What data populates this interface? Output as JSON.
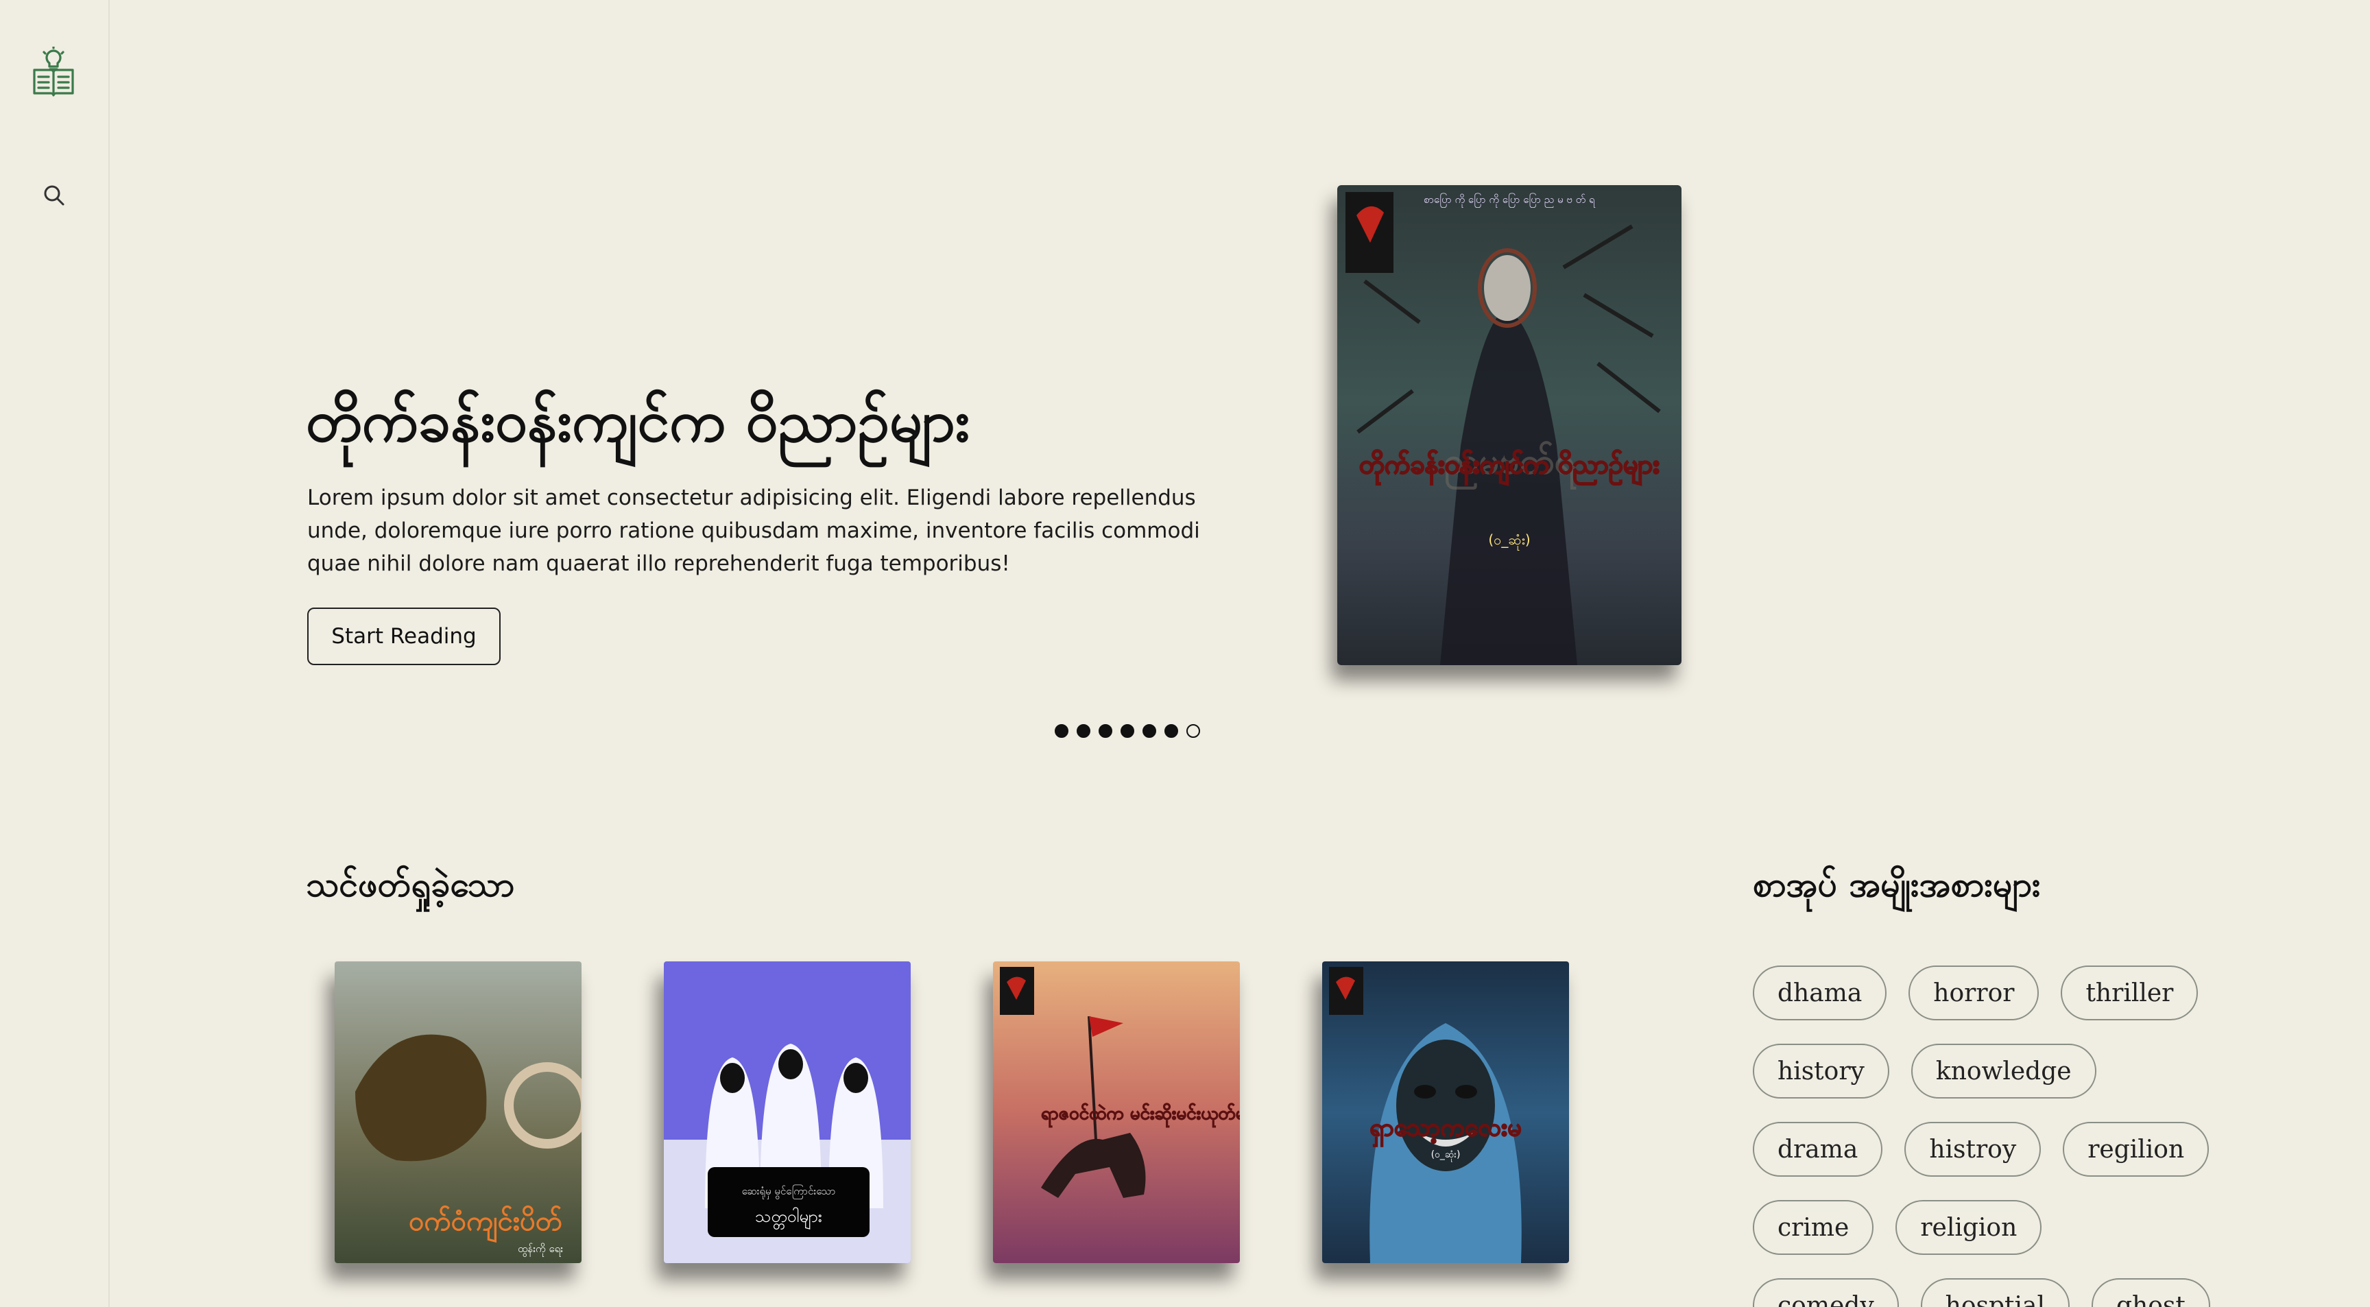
{
  "colors": {
    "background": "#f0ede2",
    "accent": "#3a7a4a",
    "text": "#111111"
  },
  "sidebar": {
    "logo_icon": "book-lightbulb-icon",
    "search_icon": "search-icon"
  },
  "hero": {
    "title": "တိုက်ခန်းဝန်းကျင်က ဝိညာဉ်များ",
    "description": "Lorem ipsum dolor sit amet consectetur adipisicing elit. Eligendi labore repellendus unde, doloremque iure porro ratione quibusdam maxime, inventore facilis commodi quae nihil dolore nam quaerat illo reprehenderit fuga temporibus!",
    "button_label": "Start Reading",
    "cover": {
      "top_text": "စာပြော ကို ပြော ကို ပြော ပြော ည မ ဗ တ် ရ",
      "title": "တိုက်ခန်းဝန်းကျင်က ဝိညာဉ်များ",
      "subtitle": "(ဝ_ဆုံး)",
      "watermark": "ညမဗတ်ရ"
    },
    "slides_total": 7,
    "active_slide": 7
  },
  "latest": {
    "title": "သင်ဖတ်ရှုခဲ့သော",
    "books": [
      {
        "title": "ဝက်ဝံကျင်းပိတ်",
        "author": "ထွန်းကို ရေး"
      },
      {
        "title": "သတ္တဝါများ",
        "author": "ဆေးရုံမှ မွင်ကြောင်းသော"
      },
      {
        "title": "ရာဇဝင်ထဲက မင်းဆိုးမင်းယုတ်များ",
        "author": ""
      },
      {
        "title": "ရှာသော့ကလေးမ",
        "author": "(ဝ_ဆုံး)"
      }
    ]
  },
  "categories": {
    "title": "စာအုပ် အမျိုးအစားများ",
    "rows": [
      [
        "dhama",
        "horror",
        "thriller"
      ],
      [
        "history",
        "knowledge"
      ],
      [
        "drama",
        "histroy",
        "regilion"
      ],
      [
        "crime",
        "religion"
      ],
      [
        "comedy",
        "hosptial",
        "ghost"
      ]
    ]
  }
}
